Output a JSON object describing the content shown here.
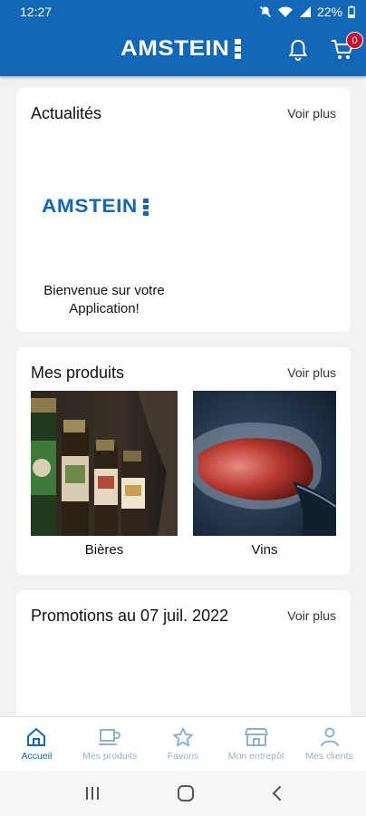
{
  "status": {
    "time": "12:27",
    "battery": "22%"
  },
  "header": {
    "brand": "AMSTEIN",
    "cart_count": "0"
  },
  "news": {
    "title": "Actualités",
    "more": "Voir plus",
    "brand": "AMSTEIN",
    "caption_line1": "Bienvenue sur votre",
    "caption_line2": "Application!"
  },
  "products": {
    "title": "Mes produits",
    "more": "Voir plus",
    "items": [
      {
        "label": "Bières"
      },
      {
        "label": "Vins"
      }
    ]
  },
  "promotions": {
    "title": "Promotions au 07 juil. 2022",
    "more": "Voir plus"
  },
  "nav": {
    "items": [
      {
        "label": "Accueil",
        "icon": "home-icon",
        "active": true
      },
      {
        "label": "Mes produits",
        "icon": "cup-icon",
        "active": false
      },
      {
        "label": "Favoris",
        "icon": "star-icon",
        "active": false
      },
      {
        "label": "Mon entrepôt",
        "icon": "store-icon",
        "active": false
      },
      {
        "label": "Mes clients",
        "icon": "person-icon",
        "active": false
      }
    ]
  },
  "colors": {
    "primary": "#1267b6",
    "badge": "#c8102e",
    "nav_inactive": "#8fb2d3"
  }
}
